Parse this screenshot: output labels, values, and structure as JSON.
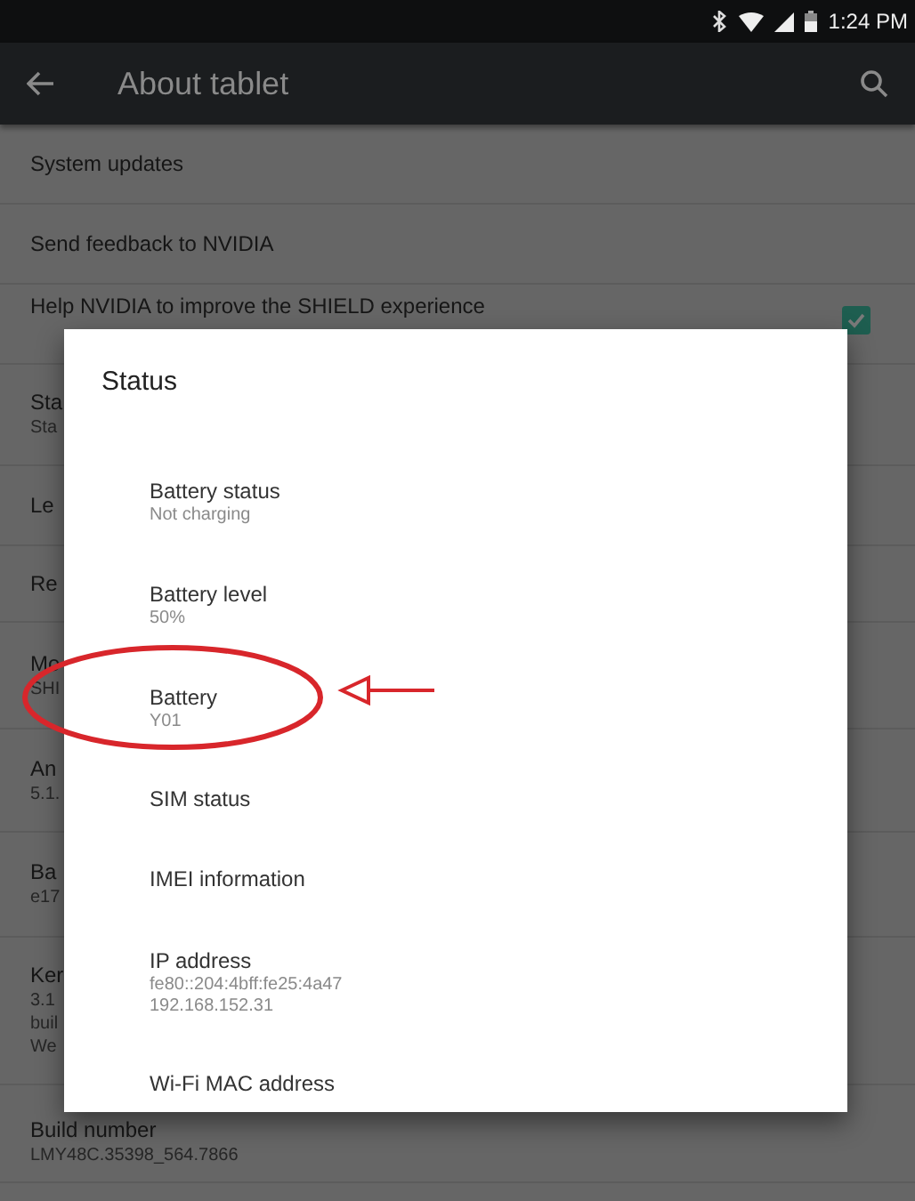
{
  "status_bar": {
    "time": "1:24 PM"
  },
  "toolbar": {
    "title": "About tablet"
  },
  "settings": [
    {
      "kind": "plain",
      "title": "System updates"
    },
    {
      "kind": "plain",
      "title": "Send feedback to NVIDIA"
    },
    {
      "kind": "checkbox",
      "title": "Help NVIDIA to improve the SHIELD experience",
      "checked": true
    },
    {
      "kind": "plain",
      "title": "Sta",
      "lines": [
        "Sta"
      ]
    },
    {
      "kind": "plain",
      "title": "Le"
    },
    {
      "kind": "plain",
      "title": "Re"
    },
    {
      "kind": "plain",
      "title": "Mo",
      "lines": [
        "SHI"
      ]
    },
    {
      "kind": "plain",
      "title": "An",
      "lines": [
        "5.1."
      ]
    },
    {
      "kind": "plain",
      "title": "Ba",
      "lines": [
        "e17"
      ]
    },
    {
      "kind": "plain",
      "title": "Ker",
      "lines": [
        "3.1",
        "buil",
        "We"
      ]
    },
    {
      "kind": "plain",
      "title": "Build number",
      "lines": [
        "LMY48C.35398_564.7866"
      ]
    }
  ],
  "dialog": {
    "title": "Status",
    "items": [
      {
        "title": "Battery status",
        "lines": [
          "Not charging"
        ]
      },
      {
        "title": "Battery level",
        "lines": [
          "50%"
        ]
      },
      {
        "title": "Battery",
        "lines": [
          "Y01"
        ]
      },
      {
        "title": "SIM status"
      },
      {
        "title": "IMEI information"
      },
      {
        "title": "IP address",
        "lines": [
          "fe80::204:4bff:fe25:4a47",
          "192.168.152.31"
        ]
      },
      {
        "title": "Wi-Fi MAC address"
      }
    ]
  }
}
